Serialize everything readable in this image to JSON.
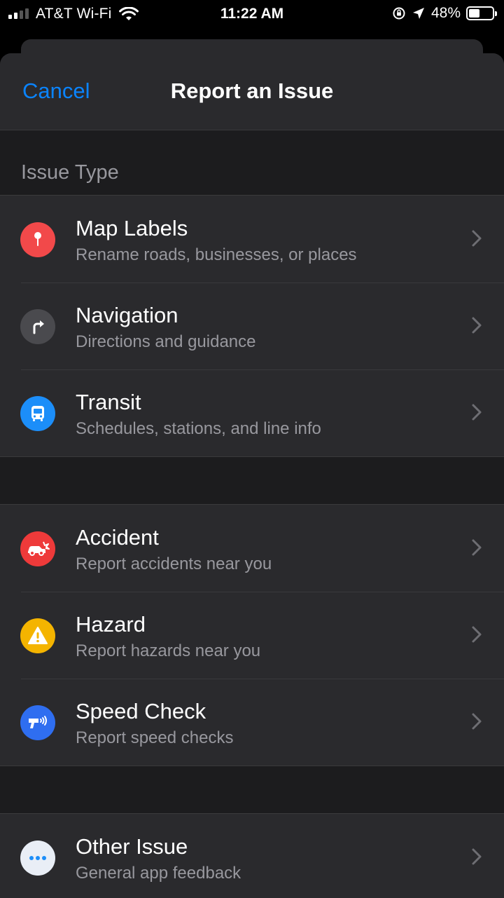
{
  "status_bar": {
    "carrier": "AT&T Wi-Fi",
    "time": "11:22 AM",
    "battery_percent": "48%",
    "battery_level": 0.48
  },
  "header": {
    "cancel_label": "Cancel",
    "title": "Report an Issue"
  },
  "section": {
    "title": "Issue Type"
  },
  "issue_groups": [
    {
      "items": [
        {
          "title": "Map Labels",
          "subtitle": "Rename roads, businesses, or places",
          "icon": "map-pin-icon",
          "color": "#f2494a"
        },
        {
          "title": "Navigation",
          "subtitle": "Directions and guidance",
          "icon": "turn-right-arrow-icon",
          "color": "#4a4a4e"
        },
        {
          "title": "Transit",
          "subtitle": "Schedules, stations, and line info",
          "icon": "bus-icon",
          "color": "#1c8ef9"
        }
      ]
    },
    {
      "items": [
        {
          "title": "Accident",
          "subtitle": "Report accidents near you",
          "icon": "car-crash-icon",
          "color": "#ee3a3a"
        },
        {
          "title": "Hazard",
          "subtitle": "Report hazards near you",
          "icon": "warning-icon",
          "color": "#f4b400"
        },
        {
          "title": "Speed Check",
          "subtitle": "Report speed checks",
          "icon": "speed-gun-icon",
          "color": "#2f6ef0"
        }
      ]
    },
    {
      "items": [
        {
          "title": "Other Issue",
          "subtitle": "General app feedback",
          "icon": "more-ellipsis-icon",
          "color": "#e9eef6"
        }
      ]
    }
  ],
  "colors": {
    "accent": "#0a84ff",
    "background": "#1c1c1e",
    "cell": "#2a2a2d",
    "secondary_text": "#98989e"
  }
}
